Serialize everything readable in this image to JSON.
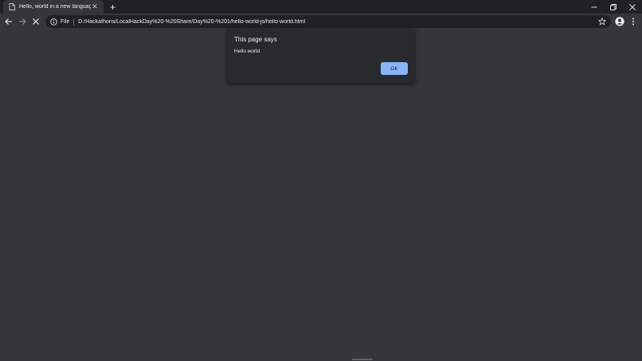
{
  "window": {
    "controls": {
      "minimize": "—",
      "maximize": "❐",
      "close": "✕"
    }
  },
  "tab": {
    "title": "Hello, world in a new language",
    "close_glyph": "✕",
    "favicon": "page-icon"
  },
  "new_tab": {
    "glyph": "+"
  },
  "toolbar": {
    "scheme_label": "File",
    "url": "D:/Hackathons/LocalHackDay%20-%20Share/Day%20-%201/hello-world-js/hello-world.html"
  },
  "dialog": {
    "title": "This page says",
    "message": "Hello world",
    "ok_label": "OK"
  },
  "colors": {
    "page_bg": "#35363a",
    "tabstrip_bg": "#202124",
    "omnibox_bg": "#202124",
    "dialog_bg": "#292a2d",
    "accent": "#8ab4f8"
  }
}
